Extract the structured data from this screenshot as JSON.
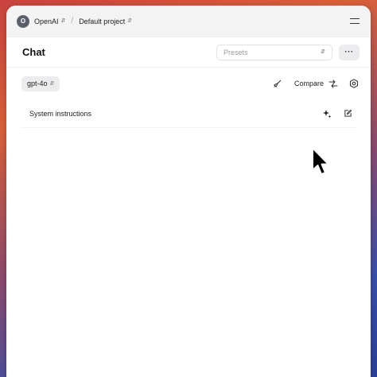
{
  "topbar": {
    "org_initial": "O",
    "org_name": "OpenAI",
    "separator": "/",
    "project_name": "Default project"
  },
  "header": {
    "title": "Chat",
    "presets_placeholder": "Presets",
    "more_label": "···"
  },
  "toolbar": {
    "model": "gpt-4o",
    "compare_label": "Compare"
  },
  "system": {
    "label": "System instructions"
  },
  "icons": {
    "clear": "broom-icon",
    "compare": "compare-icon",
    "settings": "gear-icon",
    "generate": "sparkle-icon",
    "edit": "edit-icon"
  }
}
